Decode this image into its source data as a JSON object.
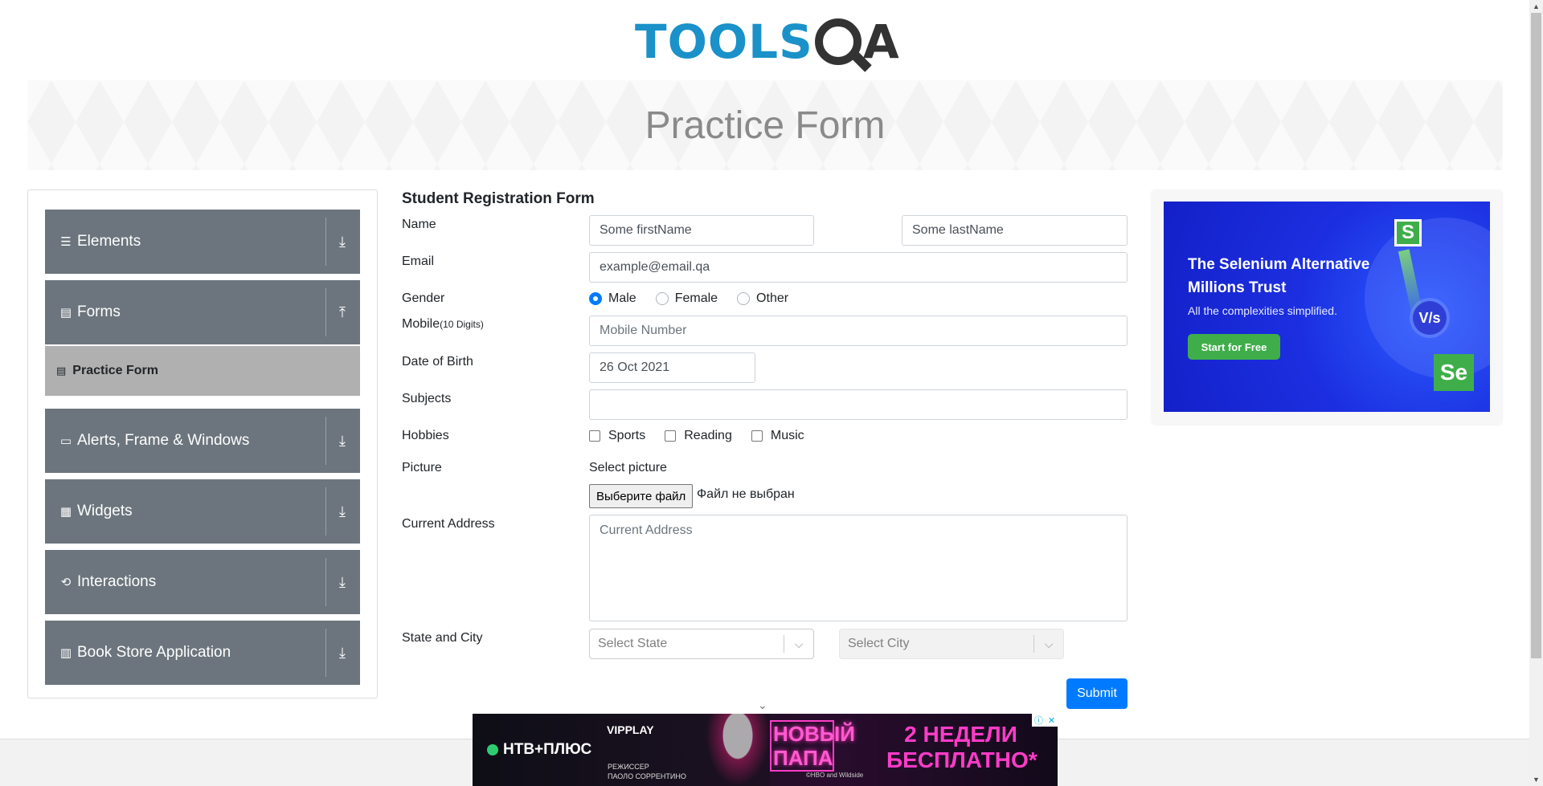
{
  "header": {
    "logo_tools": "TOOLS",
    "logo_qa": "A",
    "banner_title": "Practice Form"
  },
  "menu": {
    "groups": [
      {
        "label": "Elements",
        "icon": "hamburger-icon",
        "state": "collapsed"
      },
      {
        "label": "Forms",
        "icon": "document-icon",
        "state": "expanded"
      },
      {
        "label": "Alerts, Frame & Windows",
        "icon": "window-icon",
        "state": "collapsed"
      },
      {
        "label": "Widgets",
        "icon": "grid-icon",
        "state": "collapsed"
      },
      {
        "label": "Interactions",
        "icon": "interaction-icon",
        "state": "collapsed"
      },
      {
        "label": "Book Store Application",
        "icon": "books-icon",
        "state": "collapsed"
      }
    ],
    "active_item": {
      "label": "Practice Form",
      "icon": "form-icon"
    }
  },
  "form": {
    "title": "Student Registration Form",
    "name_label": "Name",
    "first_name_value": "Some firstName",
    "last_name_value": "Some lastName",
    "email_label": "Email",
    "email_value": "example@email.qa",
    "gender_label": "Gender",
    "gender_options": [
      "Male",
      "Female",
      "Other"
    ],
    "gender_selected": "Male",
    "mobile_label": "Mobile",
    "mobile_hint": "(10 Digits)",
    "mobile_placeholder": "Mobile Number",
    "dob_label": "Date of Birth",
    "dob_value": "26 Oct 2021",
    "subjects_label": "Subjects",
    "subjects_value": "",
    "hobbies_label": "Hobbies",
    "hobbies": [
      "Sports",
      "Reading",
      "Music"
    ],
    "picture_label": "Picture",
    "select_picture": "Select picture",
    "file_button": "Выберите файл",
    "file_status": "Файл не выбран",
    "address_label": "Current Address",
    "address_placeholder": "Current Address",
    "state_city_label": "State and City",
    "state_placeholder": "Select State",
    "city_placeholder": "Select City",
    "submit": "Submit"
  },
  "ad_right": {
    "title": "The Selenium Alternative Millions Trust",
    "subtitle": "All the complexities simplified.",
    "cta": "Start for Free",
    "logo_s": "S",
    "logo_vs": "V/s",
    "logo_se": "Se"
  },
  "ad_bottom": {
    "channel": "НТВ+ПЛЮС",
    "brand": "VIPPLAY",
    "director": "РЕЖИССЕР",
    "director_name": "ПАОЛО СОРРЕНТИНО",
    "show_title": "НОВЫЙ ПАПА",
    "offer": "2 НЕДЕЛИ БЕСПЛАТНО*",
    "credit": "©HBO and Wildside"
  },
  "colors": {
    "menu_bg": "#6c757d",
    "active_item_bg": "#b0b0b0",
    "primary": "#007bff",
    "logo_blue": "#1a91c9",
    "ad_blue": "#1c2fe0",
    "ad_green": "#3fae4a"
  }
}
